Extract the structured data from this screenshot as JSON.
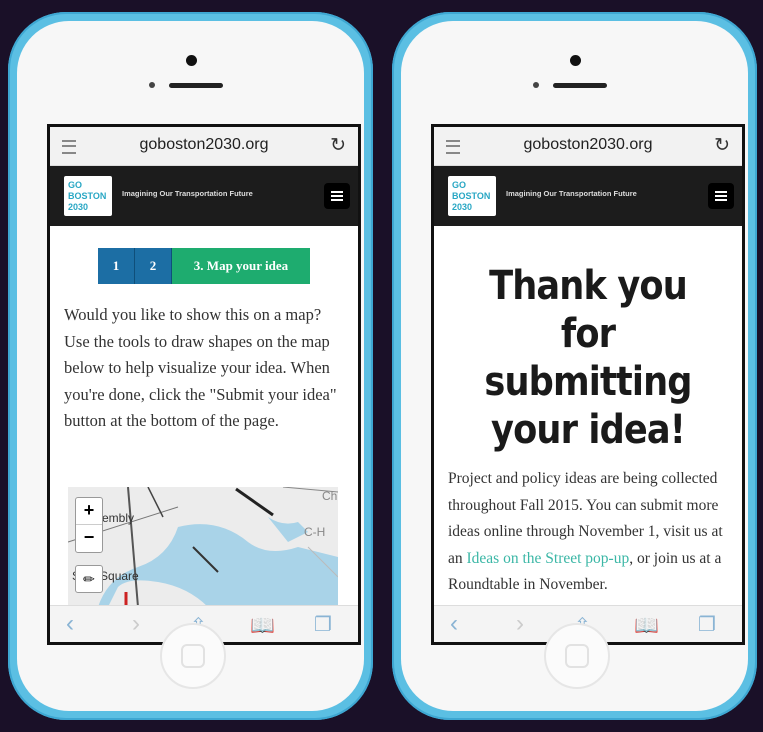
{
  "left_phone": {
    "browser": {
      "url": "goboston2030.org"
    },
    "header": {
      "logo_lines": [
        "GO",
        "BOSTON",
        "2030"
      ],
      "tagline": "Imagining Our Transportation Future"
    },
    "steps": [
      "1",
      "2",
      "3. Map your idea"
    ],
    "instructions": "Would you like to show this on a map? Use the tools to draw shapes on the map below to help visualize your idea. When you're done, click the \"Submit your idea\" button at the bottom of the page.",
    "map": {
      "zoom_in": "+",
      "zoom_out": "−",
      "labels": [
        "embly",
        "Sq n Square",
        "C-H",
        "Ch"
      ]
    }
  },
  "right_phone": {
    "browser": {
      "url": "goboston2030.org"
    },
    "header": {
      "logo_lines": [
        "GO",
        "BOSTON",
        "2030"
      ],
      "tagline": "Imagining Our Transportation Future"
    },
    "heading": "Thank you for submitting your idea!",
    "body_before_link": "Project and policy ideas are being collected throughout Fall 2015. You can submit more ideas online through November 1, visit us at an ",
    "link_text": "Ideas on the Street pop-up",
    "body_after_link": ", or join us at a Roundtable in November."
  },
  "colors": {
    "step_blue": "#1c6ea4",
    "step_green": "#1eac6f",
    "link": "#3bb7a6",
    "phone_body": "#5bbfe3"
  },
  "icons": [
    "menu-icon",
    "reload-icon",
    "hamburger-icon",
    "back-icon",
    "forward-icon",
    "share-icon",
    "bookmarks-icon",
    "tabs-icon",
    "pencil-icon"
  ]
}
